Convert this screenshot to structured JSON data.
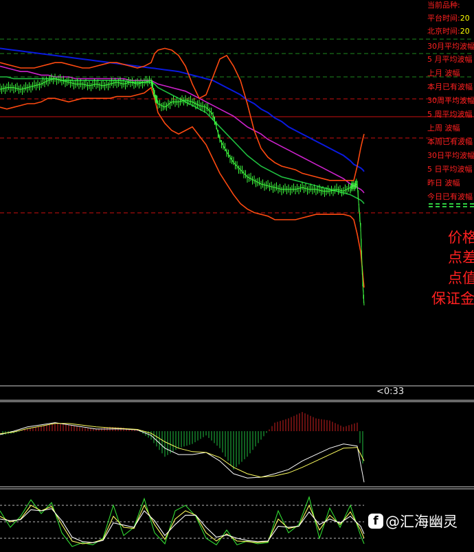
{
  "info_panel": {
    "rows": [
      {
        "label": "当前品种:",
        "value": ""
      },
      {
        "label": "平台时间:",
        "value": "20"
      },
      {
        "label": "北京时间:",
        "value": "20"
      },
      {
        "label": "30月平均波幅",
        "value": ""
      },
      {
        "label": " 5 月平均波幅",
        "value": ""
      },
      {
        "label": " 上月    波幅",
        "value": ""
      },
      {
        "label": " 本月已有波幅",
        "value": ""
      },
      {
        "label": "30周平均波幅",
        "value": ""
      },
      {
        "label": " 5 周平均波幅",
        "value": ""
      },
      {
        "label": " 上周    波幅",
        "value": ""
      },
      {
        "label": " 本周已有波幅",
        "value": ""
      },
      {
        "label": "30日平均波幅",
        "value": ""
      },
      {
        "label": " 5 日平均波幅",
        "value": ""
      },
      {
        "label": " 昨日    波幅",
        "value": ""
      },
      {
        "label": " 今日已有波幅",
        "value": ""
      }
    ],
    "big_labels": [
      "价格",
      "点差",
      "点值",
      "保证金"
    ]
  },
  "countdown": "<0:33",
  "watermark": {
    "icon": "f",
    "text": "@汇海幽灵"
  },
  "colors": {
    "background": "#000000",
    "price": "#40ff40",
    "ma_green": "#20c040",
    "ma_magenta": "#cc22cc",
    "ma_blue": "#0a1ae0",
    "band_orange": "#ff4a10",
    "signal_yellow": "#ffff60",
    "level_red": "#cc1010",
    "level_green_dash": "#1e8a1e",
    "hist_pos": "#cc2020",
    "hist_neg": "#20c040"
  },
  "chart_data": [
    {
      "type": "line",
      "panel": "price",
      "x": [
        0,
        10,
        20,
        30,
        40,
        50,
        60,
        70,
        80,
        90,
        100,
        110,
        120,
        130,
        140,
        150,
        160,
        170,
        180,
        190,
        200,
        210,
        220,
        225,
        230,
        240,
        250,
        260,
        270,
        280,
        290,
        300,
        310,
        320,
        330,
        340,
        350,
        360,
        370,
        380,
        390,
        400,
        410,
        420,
        430,
        440,
        450,
        460,
        470,
        480,
        490,
        500,
        510,
        515,
        520,
        525,
        528,
        530
      ],
      "ylim": [
        0,
        100
      ],
      "series": [
        {
          "key": "price",
          "values": [
            23,
            24,
            24,
            23,
            24,
            25,
            26,
            28,
            29,
            28,
            27,
            26,
            26,
            25,
            26,
            25,
            26,
            27,
            26,
            27,
            26,
            27,
            28,
            20,
            15,
            13,
            16,
            16,
            17,
            16,
            14,
            13,
            9,
            -5,
            -12,
            -18,
            -22,
            -26,
            -28,
            -30,
            -31,
            -32,
            -33,
            -33,
            -33,
            -32,
            -33,
            -33,
            -34,
            -34,
            -33,
            -34,
            -32,
            -31,
            -30,
            -55,
            -85,
            -98
          ]
        },
        {
          "key": "ma_blue",
          "values": [
            46,
            45.5,
            45,
            44.5,
            44,
            43.5,
            43,
            42.5,
            42,
            41.5,
            41,
            40.5,
            40,
            39.5,
            39,
            38.5,
            38,
            37.5,
            37,
            36.5,
            36,
            35.5,
            35,
            34.8,
            34.5,
            34,
            33.5,
            33,
            32,
            31,
            30,
            29,
            28,
            26,
            24,
            22,
            20,
            17,
            15,
            12,
            10,
            7,
            5,
            2,
            0,
            -2,
            -4,
            -6,
            -8,
            -10,
            -12,
            -14,
            -17,
            -19,
            -20,
            -21,
            -22,
            -23
          ]
        },
        {
          "key": "ma_magenta",
          "values": [
            36,
            35,
            34,
            33,
            33,
            32,
            31,
            31,
            30,
            30,
            30,
            29,
            29,
            29,
            29,
            29,
            29,
            29,
            29,
            28,
            28,
            28,
            28,
            27,
            26,
            25,
            24,
            23,
            22,
            20,
            18,
            16,
            14,
            12,
            10,
            8,
            5,
            2,
            0,
            -2,
            -5,
            -7,
            -9,
            -11,
            -13,
            -15,
            -17,
            -19,
            -21,
            -23,
            -25,
            -27,
            -30,
            -31,
            -32,
            -33,
            -34,
            -35
          ]
        },
        {
          "key": "ma_green",
          "values": [
            30,
            30,
            29,
            29,
            29,
            29,
            29,
            29,
            29,
            28,
            28,
            28,
            28,
            28,
            28,
            28,
            28,
            28,
            28,
            27,
            27,
            27,
            27,
            26,
            24,
            22,
            20,
            18,
            16,
            14,
            12,
            10,
            6,
            2,
            -2,
            -6,
            -10,
            -14,
            -17,
            -20,
            -22,
            -24,
            -26,
            -27,
            -28,
            -29,
            -30,
            -31,
            -32,
            -33,
            -34,
            -35,
            -36,
            -37,
            -38,
            -39,
            -40,
            -41
          ]
        },
        {
          "key": "band_upper",
          "values": [
            38,
            37,
            36,
            35,
            35,
            35,
            36,
            37,
            38,
            38,
            37,
            36,
            35,
            35,
            36,
            37,
            38,
            38,
            37,
            36,
            35,
            36,
            38,
            43,
            45,
            46,
            45,
            42,
            36,
            26,
            18,
            20,
            30,
            40,
            42,
            36,
            28,
            15,
            0,
            -10,
            -15,
            -18,
            -20,
            -21,
            -22,
            -24,
            -25,
            -26,
            -27,
            -28,
            -28,
            -28,
            -28,
            -28,
            -20,
            -10,
            -5,
            -2
          ]
        },
        {
          "key": "band_lower",
          "values": [
            13,
            12,
            13,
            14,
            15,
            15,
            16,
            18,
            18,
            17,
            16,
            17,
            18,
            18,
            18,
            18,
            18,
            19,
            19,
            19,
            20,
            21,
            24,
            18,
            10,
            4,
            0,
            -2,
            0,
            2,
            -3,
            -8,
            -16,
            -24,
            -30,
            -36,
            -41,
            -44,
            -46,
            -47,
            -48,
            -50,
            -50,
            -50,
            -50,
            -49,
            -48,
            -47,
            -47,
            -47,
            -47,
            -47,
            -48,
            -50,
            -58,
            -68,
            -80,
            -88
          ]
        }
      ]
    },
    {
      "type": "bar",
      "panel": "macd",
      "ylim": [
        -100,
        100
      ],
      "x": [
        0,
        20,
        40,
        60,
        80,
        100,
        120,
        140,
        160,
        180,
        200,
        220,
        240,
        260,
        280,
        300,
        320,
        340,
        360,
        380,
        400,
        420,
        440,
        460,
        480,
        500,
        520,
        530
      ],
      "series": [
        {
          "key": "histogram",
          "values": [
            -10,
            -5,
            5,
            12,
            18,
            15,
            8,
            5,
            10,
            8,
            3,
            -20,
            -60,
            -40,
            -30,
            -10,
            -40,
            -90,
            -60,
            -20,
            20,
            30,
            45,
            30,
            25,
            10,
            20,
            -100
          ]
        },
        {
          "key": "macd_white",
          "values": [
            -8,
            0,
            10,
            15,
            20,
            15,
            10,
            5,
            5,
            5,
            3,
            -10,
            -40,
            -55,
            -55,
            -50,
            -70,
            -100,
            -110,
            -108,
            -100,
            -90,
            -70,
            -55,
            -40,
            -30,
            -35,
            -120
          ]
        },
        {
          "key": "signal_yellow",
          "values": [
            -6,
            -2,
            6,
            12,
            18,
            18,
            14,
            10,
            8,
            6,
            4,
            -5,
            -25,
            -40,
            -48,
            -50,
            -62,
            -85,
            -100,
            -108,
            -105,
            -98,
            -85,
            -70,
            -55,
            -40,
            -38,
            -70
          ]
        }
      ]
    },
    {
      "type": "line",
      "panel": "oscillator",
      "ylim": [
        0,
        100
      ],
      "levels": [
        80,
        50,
        20
      ],
      "x": [
        0,
        15,
        30,
        45,
        60,
        75,
        90,
        105,
        120,
        135,
        150,
        165,
        180,
        195,
        210,
        225,
        240,
        255,
        270,
        285,
        300,
        315,
        330,
        345,
        360,
        375,
        390,
        405,
        420,
        435,
        450,
        465,
        480,
        495,
        510,
        525,
        530
      ],
      "series": [
        {
          "key": "osc_green",
          "values": [
            70,
            40,
            60,
            90,
            65,
            85,
            30,
            5,
            12,
            8,
            20,
            80,
            25,
            40,
            92,
            30,
            10,
            70,
            80,
            60,
            20,
            8,
            35,
            8,
            15,
            10,
            12,
            70,
            30,
            45,
            95,
            20,
            75,
            40,
            80,
            25,
            10
          ]
        },
        {
          "key": "osc_yellow",
          "values": [
            60,
            50,
            55,
            80,
            70,
            78,
            45,
            15,
            10,
            12,
            18,
            60,
            40,
            38,
            80,
            45,
            18,
            55,
            70,
            62,
            30,
            15,
            28,
            15,
            14,
            12,
            14,
            55,
            38,
            42,
            80,
            35,
            62,
            45,
            68,
            35,
            20
          ]
        },
        {
          "key": "osc_white",
          "values": [
            55,
            52,
            54,
            72,
            70,
            74,
            52,
            22,
            14,
            12,
            16,
            48,
            44,
            40,
            70,
            52,
            25,
            45,
            62,
            62,
            40,
            22,
            26,
            20,
            16,
            14,
            15,
            42,
            40,
            42,
            68,
            45,
            55,
            48,
            60,
            42,
            28
          ]
        }
      ]
    }
  ]
}
